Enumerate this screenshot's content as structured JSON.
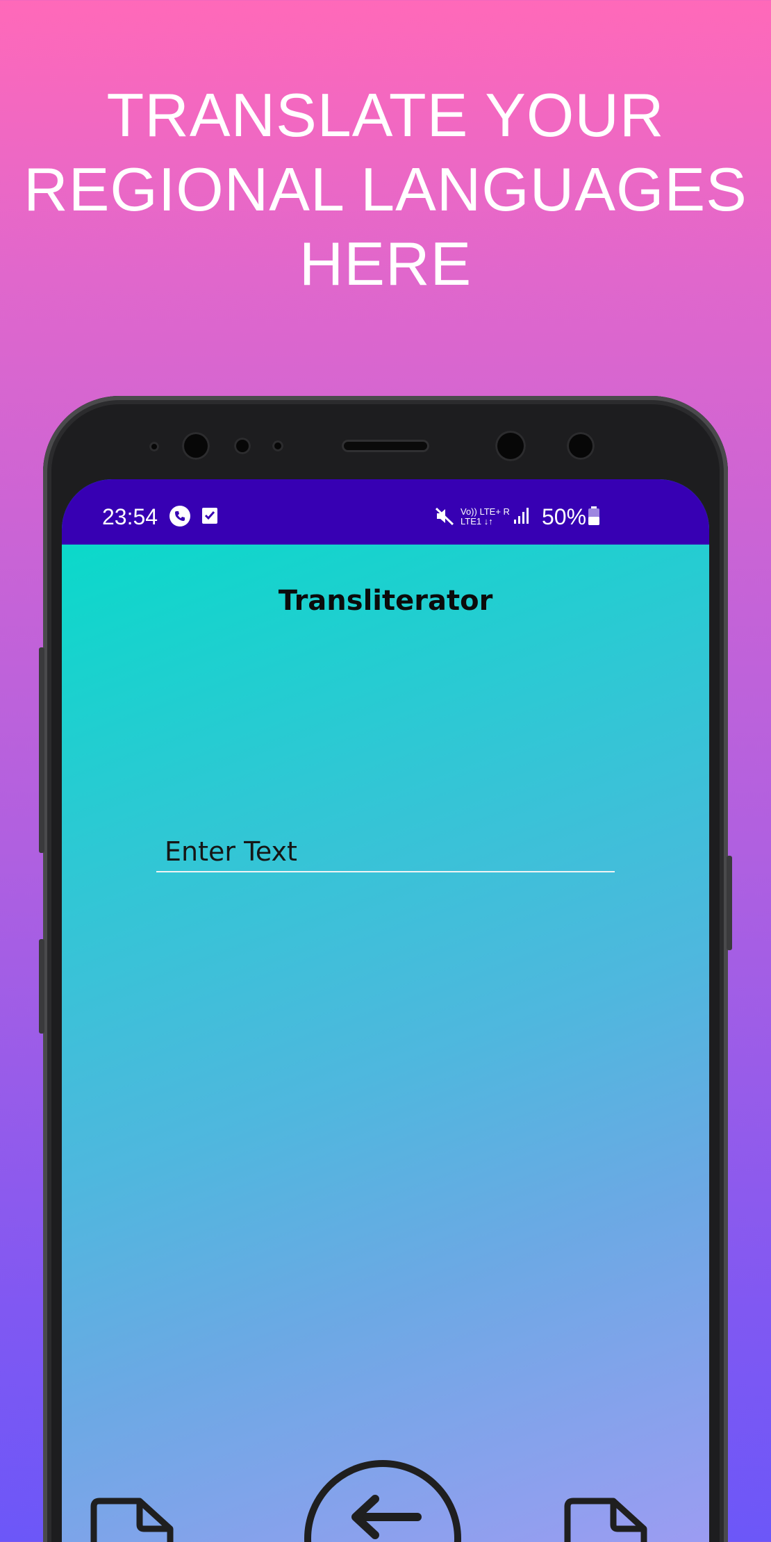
{
  "promo": {
    "line1": "TRANSLATE YOUR",
    "line2": "REGIONAL LANGUAGES",
    "line3": "HERE"
  },
  "status_bar": {
    "time": "23:54",
    "network_top": "Vo)) LTE+ R",
    "network_bottom": "LTE1 ↓↑",
    "battery": "50%"
  },
  "app": {
    "title": "Transliterator",
    "input_placeholder": "Enter Text"
  },
  "icons": {
    "call": "phone-call-icon",
    "task": "checkbox-icon",
    "mute": "mute-icon",
    "signal": "signal-icon",
    "battery": "battery-icon",
    "left_doc": "document-icon",
    "swap": "swap-arrows-icon",
    "right_doc": "document-icon"
  },
  "colors": {
    "status_bar": "#3700b3",
    "title_text": "#0b0b0b"
  }
}
